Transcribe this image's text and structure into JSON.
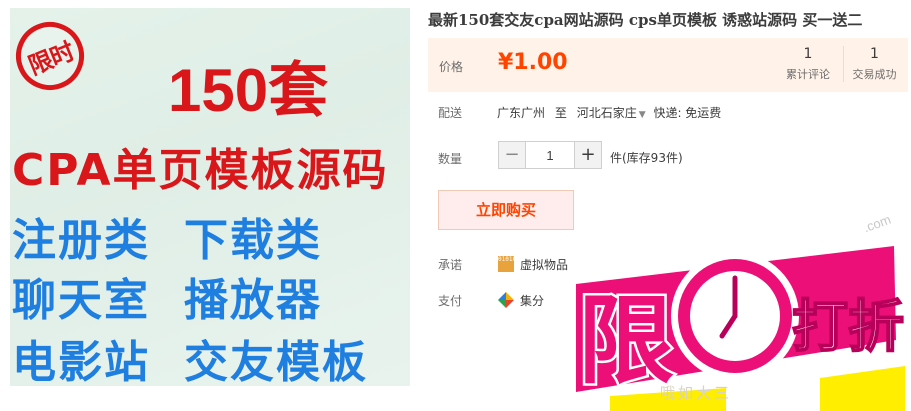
{
  "product_image": {
    "stamp_text": "限时",
    "headline": "150套",
    "line_cpa": "CPA单页模板源码",
    "rows": [
      [
        "注册类",
        "下载类"
      ],
      [
        "聊天室",
        "播放器"
      ],
      [
        "电影站",
        "交友模板"
      ]
    ]
  },
  "product": {
    "title": "最新150套交友cpa网站源码 cps单页模板 诱惑站源码 买一送二",
    "price_label": "价格",
    "price": "¥1.00",
    "reviews_count": "1",
    "reviews_label": "累计评论",
    "trades_count": "1",
    "trades_label": "交易成功",
    "shipping_label": "配送",
    "ship_from": "广东广州",
    "ship_to_word": "至",
    "ship_to": "河北石家庄",
    "ship_fee": "快递: 免运费",
    "quantity_label": "数量",
    "quantity": "1",
    "quantity_minus": "−",
    "quantity_plus": "+",
    "stock": "件(库存93件)",
    "buy_button": "立即购买",
    "promise_label": "承诺",
    "promise_icon_text": "010101",
    "promise_text": "虚拟物品",
    "pay_label": "支付",
    "pay_text": "集分"
  },
  "banner": {
    "text_xian": "限",
    "text_dazhe": "打折",
    "watermark": ".com",
    "below_text": "哦如大三",
    "colors": {
      "magenta": "#ec0f78",
      "yellow": "#ffee00",
      "deep": "#b8005a"
    }
  },
  "colors": {
    "accent": "#ff4400",
    "price_bg": "#fff2e8",
    "image_red": "#d9171b",
    "image_blue": "#1f7fe0"
  }
}
